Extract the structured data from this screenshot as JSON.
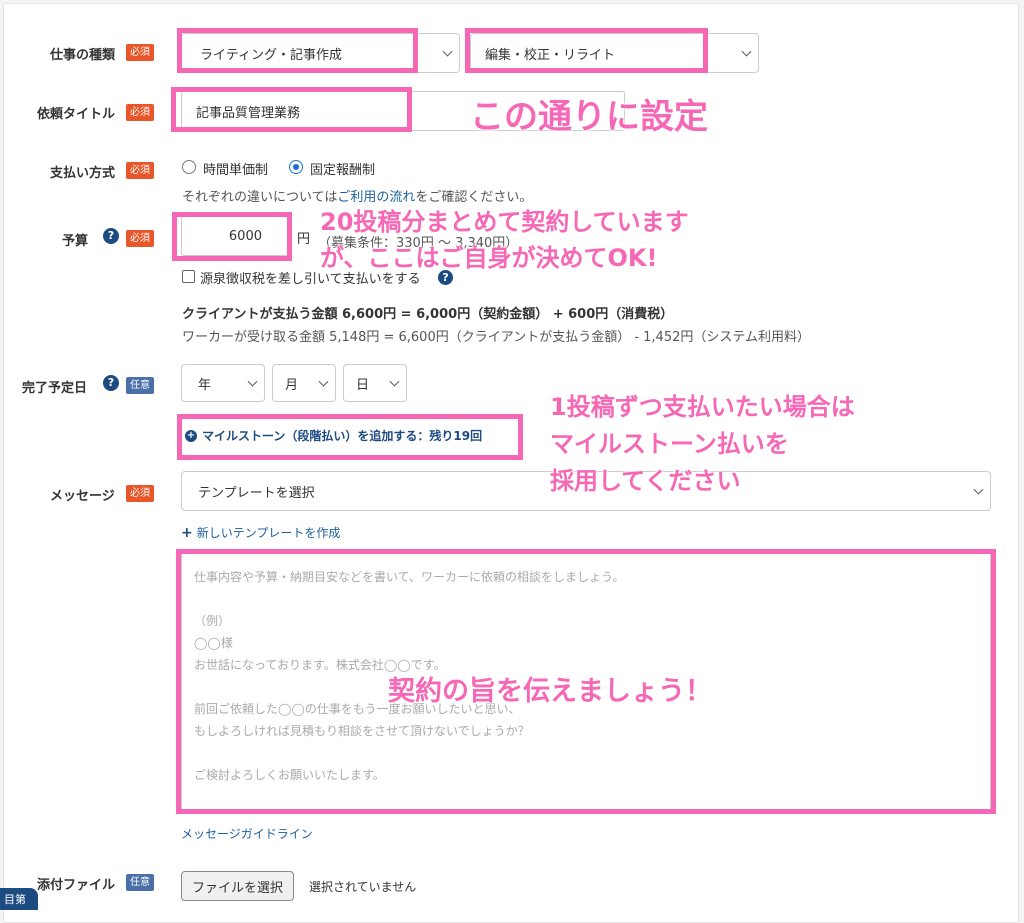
{
  "fields": {
    "job_type": {
      "label": "仕事の種類",
      "badge": "必須",
      "category": "ライティング・記事作成",
      "subcategory": "編集・校正・リライト"
    },
    "title": {
      "label": "依頼タイトル",
      "badge": "必須",
      "value": "記事品質管理業務"
    },
    "payment": {
      "label": "支払い方式",
      "badge": "必須",
      "option_hourly": "時間単価制",
      "option_fixed": "固定報酬制",
      "selected": "固定報酬制",
      "note_prefix": "それぞれの違いについては",
      "note_link": "ご利用の流れ",
      "note_suffix": "をご確認ください。"
    },
    "budget": {
      "label": "予算",
      "help": "?",
      "badge": "必須",
      "value": "6000",
      "unit": "円",
      "range_hint": "（募集条件：330円 〜 3,340円）",
      "withholding_label": "源泉徴収税を差し引いて支払いをする",
      "withholding_checked": false,
      "client_pays": "クライアントが支払う金額 6,600円 = 6,000円（契約金額） + 600円（消費税）",
      "worker_receives": "ワーカーが受け取る金額 5,148円 = 6,600円（クライアントが支払う金額） - 1,452円（システム利用料）"
    },
    "due_date": {
      "label": "完了予定日",
      "help": "?",
      "badge": "任意",
      "year": "年",
      "month": "月",
      "day": "日",
      "milestone_button": "マイルストーン（段階払い）を追加する：残り19回"
    },
    "message": {
      "label": "メッセージ",
      "badge": "必須",
      "template_select": "テンプレートを選択",
      "new_template_link": "新しいテンプレートを作成",
      "placeholder_lines": [
        "仕事内容や予算・納期目安などを書いて、ワーカーに依頼の相談をしましょう。",
        "",
        "（例）",
        "◯◯様",
        "お世話になっております。株式会社◯◯です。",
        "",
        "前回ご依頼した◯◯の仕事をもう一度お願いしたいと思い、",
        "もしよろしければ見積もり相談をさせて頂けないでしょうか？",
        "",
        "ご検討よろしくお願いいたします。"
      ],
      "guideline_link": "メッセージガイドライン"
    },
    "attachment": {
      "label": "添付ファイル",
      "badge": "任意",
      "button": "ファイルを選択",
      "status": "選択されていません"
    }
  },
  "corner_badge": "目第",
  "annotations": {
    "setting": "この通りに設定",
    "budget_line1": "20投稿分まとめて契約しています",
    "budget_line2": "が、ここはご自身が決めてOK!",
    "milestone_line1": "1投稿ずつ支払いたい場合は",
    "milestone_line2": "マイルストーン払いを",
    "milestone_line3": "採用してください",
    "message": "契約の旨を伝えましょう！"
  },
  "colors": {
    "annotation_pink": "#f667b6",
    "required_badge": "#e8562a",
    "optional_badge": "#4b6fa8",
    "link_blue": "#1c5f9e",
    "help_icon": "#1c4b82"
  }
}
